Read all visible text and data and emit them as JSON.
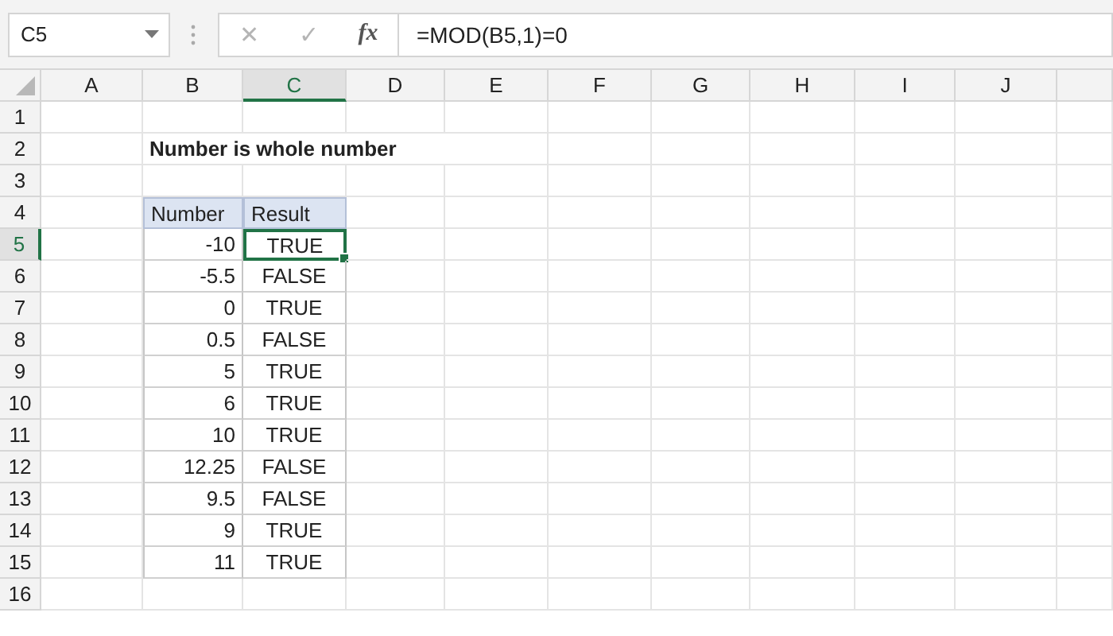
{
  "name_box": "C5",
  "formula_bar": {
    "cancel_icon": "✕",
    "enter_icon": "✓",
    "function_icon": "fx",
    "formula": "=MOD(B5,1)=0"
  },
  "columns": [
    {
      "label": "A",
      "selected": false
    },
    {
      "label": "B",
      "selected": false
    },
    {
      "label": "C",
      "selected": true
    },
    {
      "label": "D",
      "selected": false
    },
    {
      "label": "E",
      "selected": false
    },
    {
      "label": "F",
      "selected": false
    },
    {
      "label": "G",
      "selected": false
    },
    {
      "label": "H",
      "selected": false
    },
    {
      "label": "I",
      "selected": false
    },
    {
      "label": "J",
      "selected": false
    }
  ],
  "rows": [
    {
      "label": "1",
      "selected": false,
      "kind": "blank"
    },
    {
      "label": "2",
      "selected": false,
      "kind": "title",
      "b": "Number is whole number"
    },
    {
      "label": "3",
      "selected": false,
      "kind": "blank"
    },
    {
      "label": "4",
      "selected": false,
      "kind": "header",
      "b": "Number",
      "c": "Result"
    },
    {
      "label": "5",
      "selected": true,
      "kind": "data",
      "b": "-10",
      "c": "TRUE",
      "active": true
    },
    {
      "label": "6",
      "selected": false,
      "kind": "data",
      "b": "-5.5",
      "c": "FALSE",
      "active": false
    },
    {
      "label": "7",
      "selected": false,
      "kind": "data",
      "b": "0",
      "c": "TRUE",
      "active": false
    },
    {
      "label": "8",
      "selected": false,
      "kind": "data",
      "b": "0.5",
      "c": "FALSE",
      "active": false
    },
    {
      "label": "9",
      "selected": false,
      "kind": "data",
      "b": "5",
      "c": "TRUE",
      "active": false
    },
    {
      "label": "10",
      "selected": false,
      "kind": "data",
      "b": "6",
      "c": "TRUE",
      "active": false
    },
    {
      "label": "11",
      "selected": false,
      "kind": "data",
      "b": "10",
      "c": "TRUE",
      "active": false
    },
    {
      "label": "12",
      "selected": false,
      "kind": "data",
      "b": "12.25",
      "c": "FALSE",
      "active": false
    },
    {
      "label": "13",
      "selected": false,
      "kind": "data",
      "b": "9.5",
      "c": "FALSE",
      "active": false
    },
    {
      "label": "14",
      "selected": false,
      "kind": "data",
      "b": "9",
      "c": "TRUE",
      "active": false
    },
    {
      "label": "15",
      "selected": false,
      "kind": "data",
      "b": "11",
      "c": "TRUE",
      "active": false
    },
    {
      "label": "16",
      "selected": false,
      "kind": "blank"
    }
  ]
}
